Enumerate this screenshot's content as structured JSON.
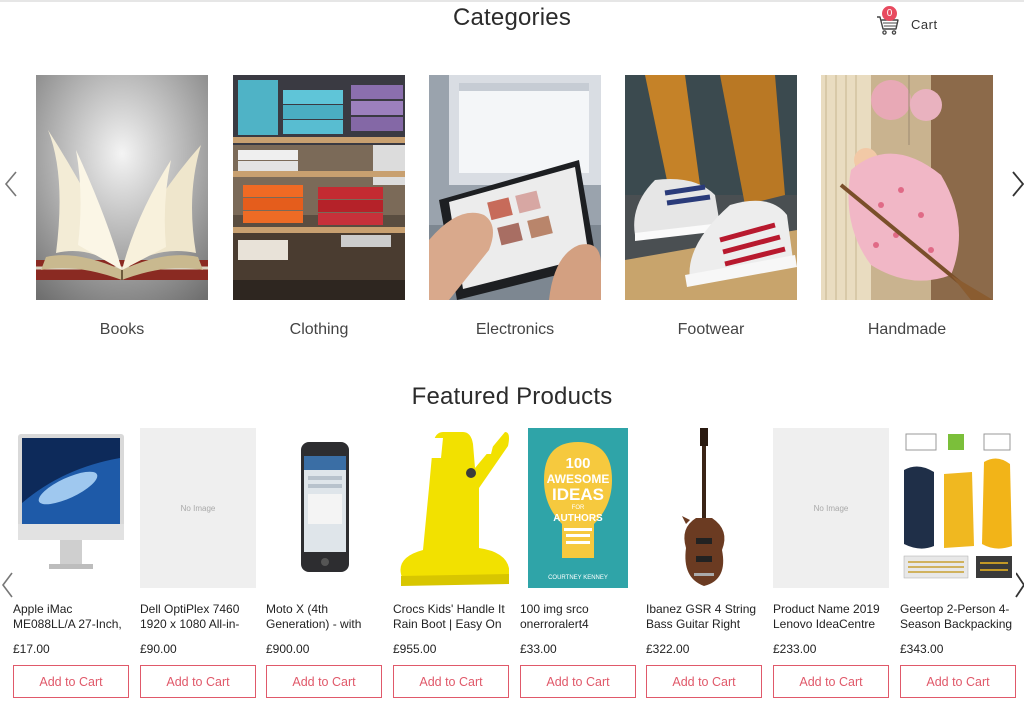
{
  "header": {
    "categories_title": "Categories",
    "cart_label": "Cart",
    "cart_count": "0"
  },
  "categories": [
    {
      "label": "Books"
    },
    {
      "label": "Clothing"
    },
    {
      "label": "Electronics"
    },
    {
      "label": "Footwear"
    },
    {
      "label": "Handmade"
    }
  ],
  "featured": {
    "title": "Featured Products",
    "no_image_text": "No Image",
    "products": [
      {
        "name1": "Apple iMac",
        "name2": "ME088LL/A 27-Inch,",
        "price": "£17.00",
        "button": "Add to Cart"
      },
      {
        "name1": "Dell OptiPlex 7460",
        "name2": "1920 x 1080 All-in-",
        "price": "£90.00",
        "button": "Add to Cart"
      },
      {
        "name1": "Moto X (4th",
        "name2": "Generation) - with",
        "price": "£900.00",
        "button": "Add to Cart"
      },
      {
        "name1": "Crocs Kids' Handle It",
        "name2": "Rain Boot | Easy On",
        "price": "£955.00",
        "button": "Add to Cart"
      },
      {
        "name1": "100 img srco",
        "name2": "onerroralert4",
        "price": "£33.00",
        "button": "Add to Cart"
      },
      {
        "name1": "Ibanez GSR 4 String",
        "name2": "Bass Guitar Right",
        "price": "£322.00",
        "button": "Add to Cart"
      },
      {
        "name1": "Product Name 2019",
        "name2": "Lenovo IdeaCentre",
        "price": "£233.00",
        "button": "Add to Cart"
      },
      {
        "name1": "Geertop 2-Person 4-",
        "name2": "Season Backpacking",
        "price": "£343.00",
        "button": "Add to Cart"
      }
    ]
  },
  "book_cover": {
    "line1": "100",
    "line2": "AWESOME",
    "line3": "IDEAS",
    "line4": "FOR",
    "line5": "AUTHORS",
    "author": "COURTNEY KENNEY"
  },
  "icons": {
    "cart": "cart-icon",
    "prev": "chevron-left-icon",
    "next": "chevron-right-icon"
  },
  "colors": {
    "accent": "#e0596a",
    "badge": "#e84a5f",
    "heading": "#2b2b2b"
  }
}
